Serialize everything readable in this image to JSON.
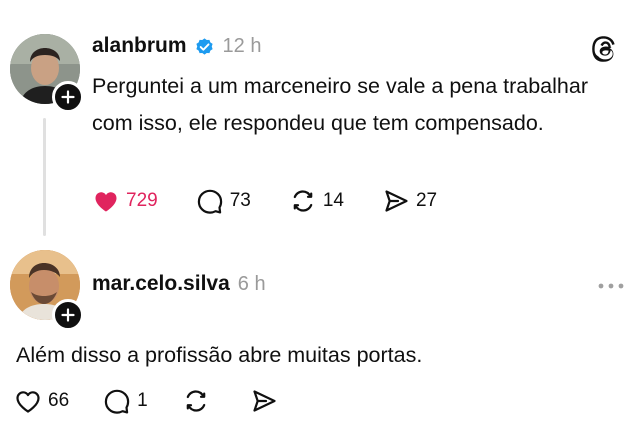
{
  "posts": [
    {
      "author": "alanbrum",
      "verified": true,
      "time": "12 h",
      "text": "Perguntei a um marceneiro se vale a pena trabalhar com isso, ele respondeu que tem compensado.",
      "likes": "729",
      "liked": true,
      "replies": "73",
      "reposts": "14",
      "shares": "27"
    },
    {
      "author": "mar.celo.silva",
      "verified": false,
      "time": "6 h",
      "text": "Além disso a profissão abre muitas portas.",
      "likes": "66",
      "liked": false,
      "replies": "1",
      "reposts": "",
      "shares": ""
    }
  ],
  "icons": {
    "brand": "threads-logo-icon",
    "like_active_color": "#e0245e",
    "verified_color": "#1d9bf0"
  }
}
